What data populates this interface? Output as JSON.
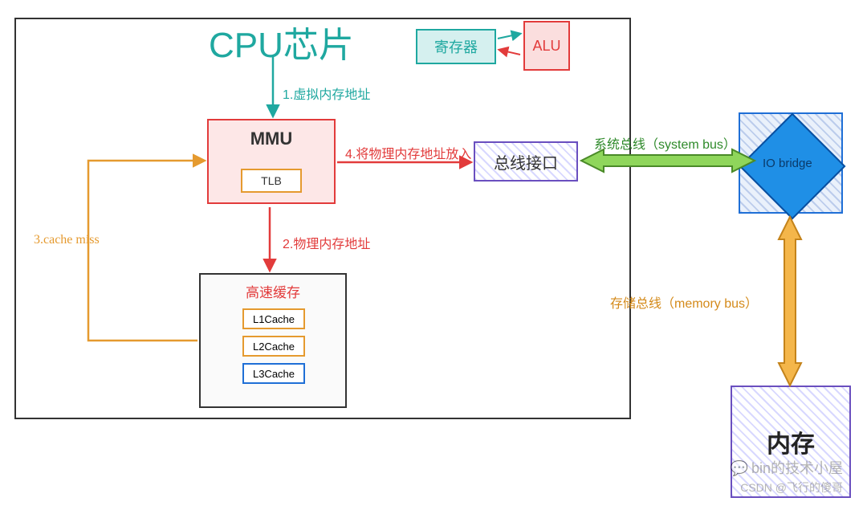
{
  "title": "CPU芯片",
  "blocks": {
    "register": "寄存器",
    "alu": "ALU",
    "mmu": "MMU",
    "tlb": "TLB",
    "bus_if": "总线接口",
    "cache_title": "高速缓存",
    "l1": "L1Cache",
    "l2": "L2Cache",
    "l3": "L3Cache",
    "io_bridge": "IO bridge",
    "memory": "内存"
  },
  "arrows": {
    "step1": "1.虚拟内存地址",
    "step2": "2.物理内存地址",
    "step3": "3.cache miss",
    "step4": "4.将物理内存地址放入",
    "system_bus": "系统总线（system bus）",
    "memory_bus": "存储总线（memory bus）"
  },
  "watermark": {
    "line1": "bin的技术小屋",
    "line2": "CSDN @飞行的傻哥"
  },
  "colors": {
    "teal": "#1fa8a0",
    "red": "#e23b3b",
    "orange": "#e59a2f",
    "green": "#5fb234",
    "blue": "#1f6fd6",
    "purple": "#6a4fbf",
    "dark": "#333333"
  }
}
